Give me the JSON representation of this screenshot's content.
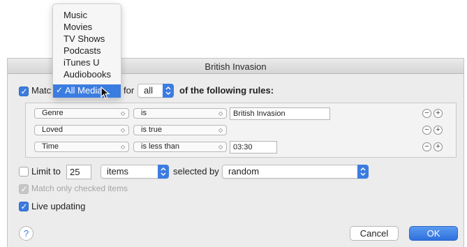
{
  "window": {
    "title": "British Invasion"
  },
  "match": {
    "checkbox_checked": true,
    "label_prefix": "Matc",
    "label_for": "for",
    "quantifier": "all",
    "suffix": "of the following rules:"
  },
  "media_menu": {
    "items": [
      "Music",
      "Movies",
      "TV Shows",
      "Podcasts",
      "iTunes U",
      "Audiobooks"
    ],
    "selected": "All Media",
    "selected_check": "✓"
  },
  "rules": [
    {
      "field": "Genre",
      "operator": "is",
      "value": "British Invasion"
    },
    {
      "field": "Loved",
      "operator": "is true",
      "value": ""
    },
    {
      "field": "Time",
      "operator": "is less than",
      "value": "03:30"
    }
  ],
  "rule_buttons": {
    "remove": "−",
    "add": "+"
  },
  "limit": {
    "checked": false,
    "label": "Limit to",
    "amount": "25",
    "unit": "items",
    "selected_by_label": "selected by",
    "selected_by": "random"
  },
  "match_only_checked": {
    "checked": true,
    "enabled": false,
    "label": "Match only checked items"
  },
  "live_updating": {
    "checked": true,
    "label": "Live updating"
  },
  "help": {
    "label": "?"
  },
  "buttons": {
    "cancel": "Cancel",
    "ok": "OK"
  },
  "colors": {
    "accent": "#3b7ce0",
    "window": "#ececec"
  },
  "icons": {
    "popup": "up-down-chevron-icon",
    "check": "checkmark-icon",
    "help": "question-icon"
  }
}
